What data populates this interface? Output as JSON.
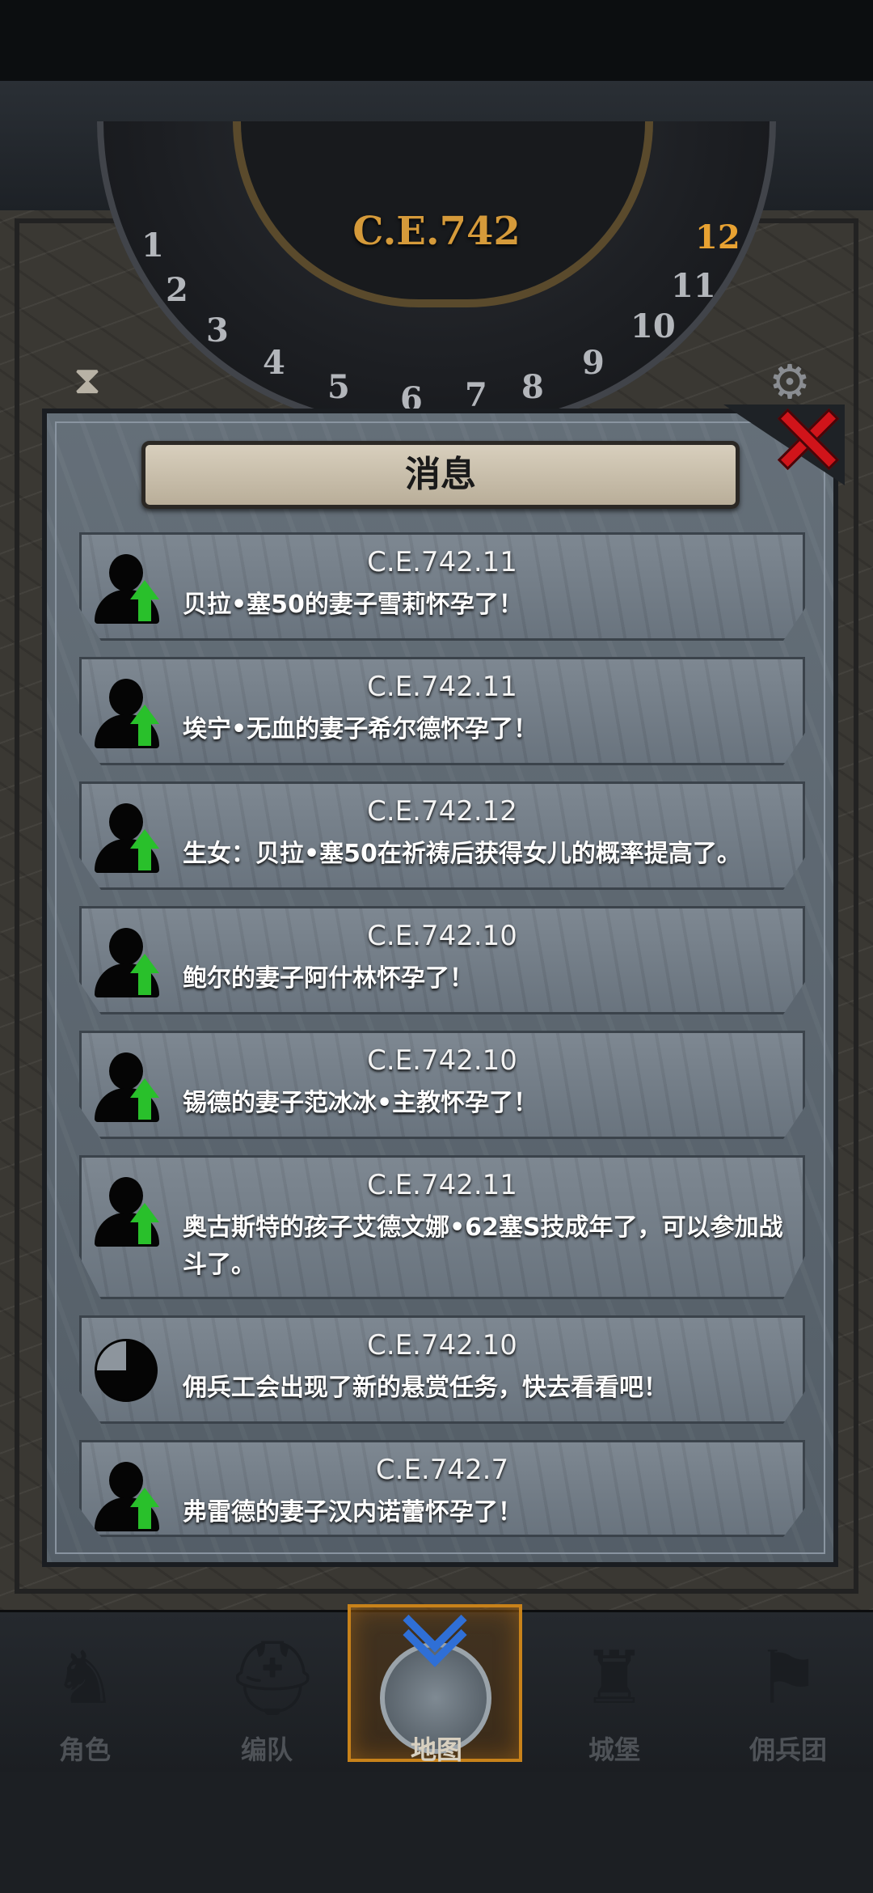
{
  "header": {
    "era": "C.E.742",
    "dial_numbers": [
      "1",
      "2",
      "3",
      "4",
      "5",
      "6",
      "7",
      "8",
      "9",
      "10",
      "11",
      "12"
    ],
    "current_month": "12",
    "hourglass_icon": "hourglass-icon",
    "settings_icon": "gear-icon"
  },
  "dialog": {
    "title": "消息",
    "close_icon": "close-icon",
    "messages": [
      {
        "date": "C.E.742.11",
        "text": "贝拉•塞50的妻子雪莉怀孕了！",
        "icon": "person-up-icon"
      },
      {
        "date": "C.E.742.11",
        "text": "埃宁•无血的妻子希尔德怀孕了！",
        "icon": "person-up-icon"
      },
      {
        "date": "C.E.742.12",
        "text": "生女：贝拉•塞50在祈祷后获得女儿的概率提高了。",
        "icon": "person-up-icon"
      },
      {
        "date": "C.E.742.10",
        "text": "鲍尔的妻子阿什林怀孕了！",
        "icon": "person-up-icon"
      },
      {
        "date": "C.E.742.10",
        "text": "锡德的妻子范冰冰•主教怀孕了！",
        "icon": "person-up-icon"
      },
      {
        "date": "C.E.742.11",
        "text": "奥古斯特的孩子艾德文娜•62塞S技成年了，可以参加战斗了。",
        "icon": "person-up-icon"
      },
      {
        "date": "C.E.742.10",
        "text": "佣兵工会出现了新的悬赏任务，快去看看吧！",
        "icon": "clock-icon"
      },
      {
        "date": "C.E.742.7",
        "text": "弗雷德的妻子汉内诺蕾怀孕了！",
        "icon": "person-up-icon"
      }
    ]
  },
  "nav": {
    "items": [
      {
        "label": "角色",
        "icon": "knight-icon"
      },
      {
        "label": "编队",
        "icon": "helmet-icon"
      },
      {
        "label": "地图",
        "icon": "map-icon",
        "active": true
      },
      {
        "label": "城堡",
        "icon": "castle-icon"
      },
      {
        "label": "佣兵团",
        "icon": "banner-icon"
      }
    ]
  },
  "colors": {
    "accent": "#d59a3a",
    "active_tab_border": "#c8821a",
    "close": "#d0141a",
    "arrow_up": "#29c02b"
  }
}
